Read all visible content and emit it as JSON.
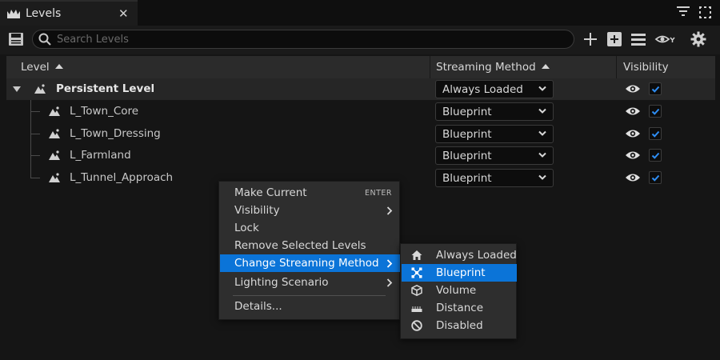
{
  "colors": {
    "accent": "#0b74d8",
    "panel_bg": "#151515",
    "menu_bg": "#2e2e2e"
  },
  "tab": {
    "title": "Levels",
    "close_glyph": "✕",
    "icon": "unreal-logo-icon"
  },
  "toolbar": {
    "search_placeholder": "Search Levels",
    "icons": [
      "save-icon",
      "search-icon",
      "add-icon",
      "add-existing-icon",
      "list-icon",
      "view-options-icon",
      "settings-icon"
    ]
  },
  "table": {
    "columns": [
      {
        "label": "Level",
        "sort": "ascending"
      },
      {
        "label": "Streaming Method",
        "sort": "ascending"
      },
      {
        "label": "Visibility"
      }
    ],
    "rows": [
      {
        "name": "Persistent Level",
        "streaming": "Always Loaded",
        "visible": true,
        "checked": true,
        "expanded": true
      },
      {
        "name": "L_Town_Core",
        "streaming": "Blueprint",
        "visible": true,
        "checked": true
      },
      {
        "name": "L_Town_Dressing",
        "streaming": "Blueprint",
        "visible": true,
        "checked": true
      },
      {
        "name": "L_Farmland",
        "streaming": "Blueprint",
        "visible": true,
        "checked": true
      },
      {
        "name": "L_Tunnel_Approach",
        "streaming": "Blueprint",
        "visible": true,
        "checked": true
      }
    ]
  },
  "context_menu": {
    "items": [
      {
        "label": "Make Current",
        "shortcut": "ENTER"
      },
      {
        "label": "Visibility",
        "submenu": true
      },
      {
        "label": "Lock"
      },
      {
        "label": "Remove Selected Levels"
      },
      {
        "label": "Change Streaming Method",
        "submenu": true,
        "active": true
      },
      {
        "label": "Lighting Scenario",
        "submenu": true
      },
      {
        "label": "Details..."
      }
    ]
  },
  "streaming_submenu": {
    "items": [
      {
        "label": "Always Loaded",
        "icon": "home-icon"
      },
      {
        "label": "Blueprint",
        "icon": "blueprint-icon",
        "active": true
      },
      {
        "label": "Volume",
        "icon": "volume-icon"
      },
      {
        "label": "Distance",
        "icon": "ruler-icon"
      },
      {
        "label": "Disabled",
        "icon": "disabled-icon"
      }
    ]
  }
}
